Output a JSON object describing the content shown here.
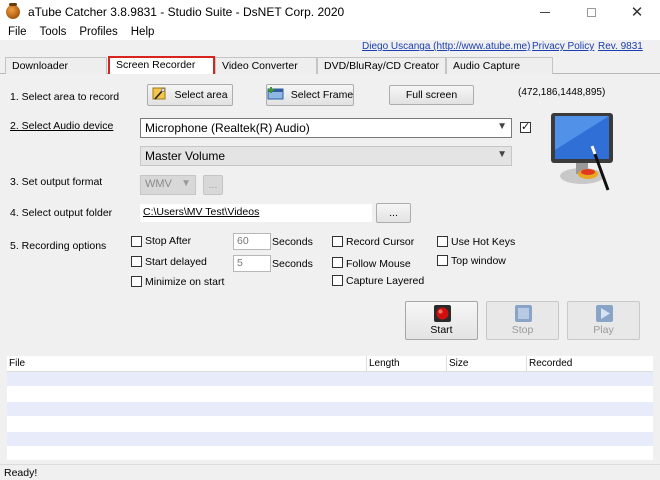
{
  "window": {
    "title": "aTube Catcher 3.8.9831 - Studio Suite - DsNET Corp. 2020"
  },
  "menu": [
    "File",
    "Tools",
    "Profiles",
    "Help"
  ],
  "links": {
    "author": "Diego Uscanga (http://www.atube.me)",
    "privacy": "Privacy Policy",
    "revision": "Rev. 9831"
  },
  "tabs": [
    "Downloader",
    "Screen Recorder",
    "Video Converter",
    "DVD/BluRay/CD Creator",
    "Audio Capture"
  ],
  "recorder": {
    "step1_label": "1. Select area to record",
    "select_area": "Select area",
    "select_frame": "Select Frame",
    "full_screen": "Full screen",
    "coords": "(472,186,1448,895)",
    "step2_label": "2. Select Audio device",
    "audio_device": "Microphone (Realtek(R) Audio)",
    "audio_source": "Master Volume",
    "step3_label": "3. Set output format",
    "format": "WMV",
    "format_more": "...",
    "step4_label": "4. Select output folder",
    "output_folder": "C:\\Users\\MV Test\\Videos",
    "browse": "...",
    "step5_label": "5. Recording options",
    "stop_after": "Stop After",
    "stop_after_value": "60",
    "start_delayed": "Start delayed",
    "start_delayed_value": "5",
    "seconds": "Seconds",
    "minimize_on_start": "Minimize on start",
    "record_cursor": "Record Cursor",
    "follow_mouse": "Follow Mouse",
    "capture_layered": "Capture Layered",
    "use_hot_keys": "Use Hot Keys",
    "top_window": "Top window",
    "start": "Start",
    "stop": "Stop",
    "play": "Play"
  },
  "table": {
    "columns": [
      "File",
      "Length",
      "Size",
      "Recorded"
    ]
  },
  "status": "Ready!",
  "colors": {
    "active_tab_border": "#d9231f",
    "link": "#1a3fb0",
    "row_alt": "#e8ebfa",
    "record": "#d01010"
  }
}
